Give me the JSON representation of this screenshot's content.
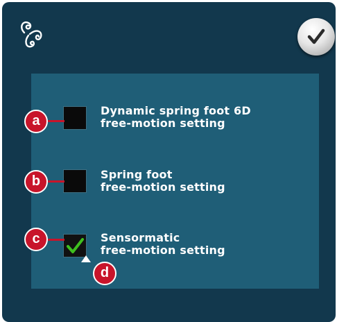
{
  "header": {
    "mode_icon": "freemotion-icon",
    "ok_icon": "checkmark-icon"
  },
  "options": [
    {
      "label_line1": "Dynamic spring foot 6D",
      "label_line2": "free-motion setting",
      "checked": false,
      "callout": "a"
    },
    {
      "label_line1": "Spring foot",
      "label_line2": "free-motion setting",
      "checked": false,
      "callout": "b"
    },
    {
      "label_line1": "Sensormatic",
      "label_line2": "free-motion setting",
      "checked": true,
      "callout": "c"
    }
  ],
  "pointer_callout": "d",
  "colors": {
    "screen_bg": "#12384d",
    "panel_bg": "#1f5e77",
    "callout_red": "#c8142a",
    "check_green": "#3fbf1f"
  }
}
